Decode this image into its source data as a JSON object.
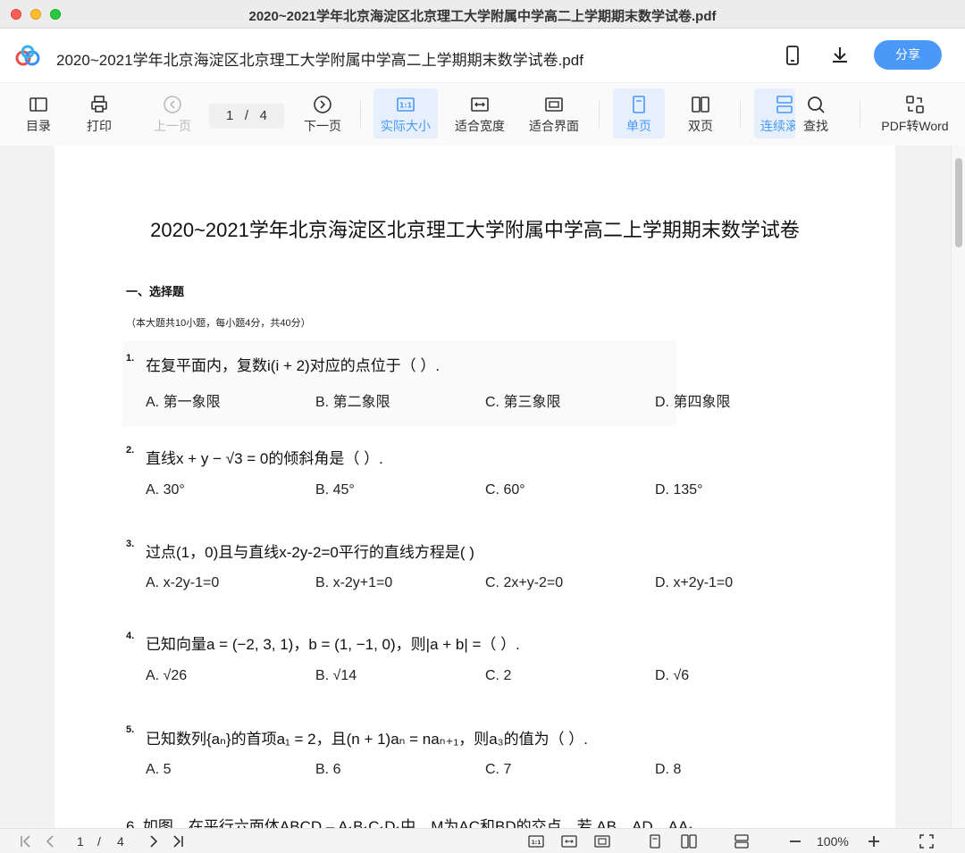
{
  "window": {
    "title": "2020~2021学年北京海淀区北京理工大学附属中学高二上学期期末数学试卷.pdf"
  },
  "header": {
    "doc_name": "2020~2021学年北京海淀区北京理工大学附属中学高二上学期期末数学试卷.pdf",
    "share_label": "分享"
  },
  "toolbar": {
    "toc": "目录",
    "print": "打印",
    "prev": "上一页",
    "page_current": "1",
    "page_sep": "/",
    "page_total": "4",
    "next": "下一页",
    "actual_size": "实际大小",
    "fit_width": "适合宽度",
    "fit_page": "适合界面",
    "single_page": "单页",
    "double_page": "双页",
    "continuous": "连续滚",
    "search": "查找",
    "pdf_to_word": "PDF转Word"
  },
  "document": {
    "title": "2020~2021学年北京海淀区北京理工大学附属中学高二上学期期末数学试卷",
    "section": "一、选择题",
    "section_note": "（本大题共10小题，每小题4分，共40分）",
    "questions": [
      {
        "num": "1.",
        "text": "在复平面内，复数i(i + 2)对应的点位于（   ）.",
        "options": [
          "A. 第一象限",
          "B. 第二象限",
          "C. 第三象限",
          "D. 第四象限"
        ]
      },
      {
        "num": "2.",
        "text": "直线x + y − √3 = 0的倾斜角是（   ）.",
        "options": [
          "A. 30°",
          "B. 45°",
          "C. 60°",
          "D. 135°"
        ]
      },
      {
        "num": "3.",
        "text": "过点(1，0)且与直线x-2y-2=0平行的直线方程是(       )",
        "options": [
          "A. x-2y-1=0",
          "B. x-2y+1=0",
          "C. 2x+y-2=0",
          "D. x+2y-1=0"
        ]
      },
      {
        "num": "4.",
        "text": "已知向量a = (−2, 3, 1)，b = (1, −1, 0)，则|a + b| =（  ）.",
        "options": [
          "A. √26",
          "B. √14",
          "C. 2",
          "D. √6"
        ]
      },
      {
        "num": "5.",
        "text": "已知数列{aₙ}的首项a₁ = 2，且(n + 1)aₙ = naₙ₊₁，则a₃的值为（  ）.",
        "options": [
          "A. 5",
          "B. 6",
          "C. 7",
          "D. 8"
        ]
      }
    ],
    "q6_partial": "6.  如图，在平行六面体ABCD – A₁B₁C₁D₁中，M为AC和BD的交点，若 AB，AD，AA₁"
  },
  "bottombar": {
    "page_current": "1",
    "page_sep": "/",
    "page_total": "4",
    "zoom": "100%"
  },
  "colors": {
    "accent": "#4a98f7",
    "active_bg": "#e6f0fd"
  }
}
